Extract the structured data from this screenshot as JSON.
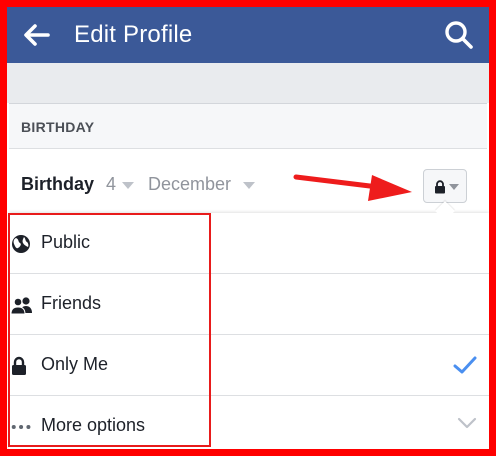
{
  "navbar": {
    "title": "Edit Profile",
    "back_icon": "arrow-left-icon",
    "search_icon": "search-icon",
    "bg_color": "#3b5998"
  },
  "section": {
    "header": "BIRTHDAY"
  },
  "birthday": {
    "label": "Birthday",
    "day": "4",
    "month": "December",
    "privacy_icon": "lock-icon"
  },
  "privacy_menu": {
    "options": [
      {
        "label": "Public",
        "icon": "globe-icon",
        "selected": false
      },
      {
        "label": "Friends",
        "icon": "friends-icon",
        "selected": false
      },
      {
        "label": "Only Me",
        "icon": "lock-icon",
        "selected": true
      },
      {
        "label": "More options",
        "icon": "more-dots-icon",
        "expandable": true
      }
    ]
  },
  "annotations": {
    "highlight_color": "#ff0000",
    "check_color": "#4a8ff0"
  }
}
